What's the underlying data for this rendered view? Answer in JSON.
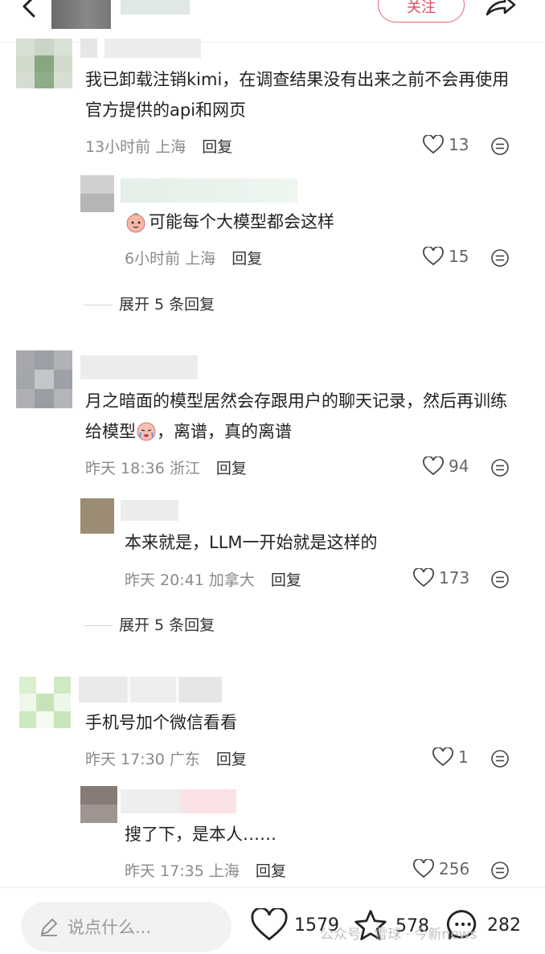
{
  "header": {
    "follow_label": "关注"
  },
  "comments": [
    {
      "text": "我已卸载注销kimi，在调查结果没有出来之前不会再使用官方提供的api和网页",
      "time": "13小时前",
      "location": "上海",
      "reply_label": "回复",
      "likes": "13",
      "replies": [
        {
          "text": "可能每个大模型都会这样",
          "time": "6小时前",
          "location": "上海",
          "reply_label": "回复",
          "likes": "15"
        }
      ],
      "expand_label": "展开 5 条回复"
    },
    {
      "text": "月之暗面的模型居然会存跟用户的聊天记录，然后再训练给模型",
      "text_tail": "，离谱，真的离谱",
      "time": "昨天 18:36",
      "location": "浙江",
      "reply_label": "回复",
      "likes": "94",
      "replies": [
        {
          "text": "本来就是，LLM一开始就是这样的",
          "time": "昨天 20:41",
          "location": "加拿大",
          "reply_label": "回复",
          "likes": "173"
        }
      ],
      "expand_label": "展开 5 条回复"
    },
    {
      "text": "手机号加个微信看看",
      "time": "昨天 17:30",
      "location": "广东",
      "reply_label": "回复",
      "likes": "1",
      "replies": [
        {
          "text": "搜了下，是本人……",
          "time": "昨天 17:35",
          "location": "上海",
          "reply_label": "回复",
          "likes": "256"
        }
      ]
    }
  ],
  "bottom_bar": {
    "input_placeholder": "说点什么...",
    "likes": "1579",
    "favorites": "578",
    "comments": "282"
  },
  "watermark": "公众号 · 雪球 · 今新news",
  "icons": [
    "back-icon",
    "share-icon",
    "heart-icon",
    "more-icon",
    "pencil-icon",
    "star-icon",
    "comment-bubble-icon",
    "emoji-sticker-icon"
  ],
  "colors": {
    "accent": "#e2495f",
    "meta_gray": "#8a8a8a"
  }
}
